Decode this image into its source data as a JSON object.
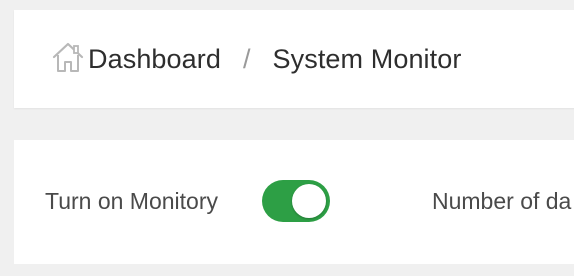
{
  "breadcrumb": {
    "home_icon": "home-icon",
    "items": [
      {
        "label": "Dashboard"
      },
      {
        "label": "System Monitor"
      }
    ],
    "separator": "/"
  },
  "monitor_panel": {
    "toggle_label": "Turn on Monitory",
    "toggle_on": true,
    "toggle_color": "#2d9f45",
    "days_label": "Number of da"
  }
}
